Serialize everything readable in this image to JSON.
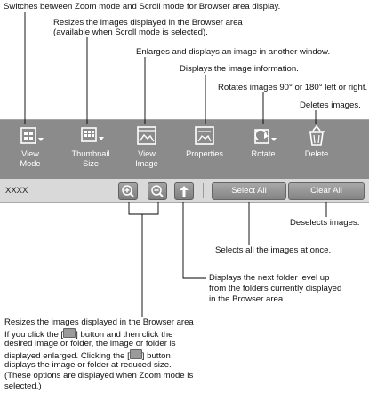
{
  "annotations": {
    "view_mode": "Switches between Zoom mode and Scroll mode for Browser area display.",
    "thumbnail_size_1": "Resizes the images displayed in the Browser area",
    "thumbnail_size_2": "(available when Scroll mode is selected).",
    "view_image": "Enlarges and displays an image in another window.",
    "properties": "Displays the image information.",
    "rotate": "Rotates images 90° or 180° left or right.",
    "delete": "Deletes images.",
    "clear_all": "Deselects images.",
    "select_all": "Selects all the images at once.",
    "up_1": "Displays the next folder level up",
    "up_2": "from the folders currently displayed",
    "up_3": "in the Browser area.",
    "zoom_1": "Resizes the images displayed in the Browser area",
    "zoom_2a": "If you click the [",
    "zoom_2b": "] button and then click the",
    "zoom_3": "desired image or folder, the image or folder is",
    "zoom_4a": "displayed enlarged. Clicking the [",
    "zoom_4b": "] button",
    "zoom_5": "displays the image or folder at reduced size.",
    "zoom_6": "(These options are displayed when Zoom mode is",
    "zoom_7": "selected.)"
  },
  "toolbar": {
    "view_mode": {
      "line1": "View",
      "line2": "Mode",
      "icon": "view-mode-icon"
    },
    "thumbnail_size": {
      "line1": "Thumbnail",
      "line2": "Size",
      "icon": "thumbnail-size-icon"
    },
    "view_image": {
      "line1": "View",
      "line2": "Image",
      "icon": "view-image-icon"
    },
    "properties": {
      "line1": "Properties",
      "icon": "properties-icon"
    },
    "rotate": {
      "line1": "Rotate",
      "icon": "rotate-icon"
    },
    "delete": {
      "line1": "Delete",
      "icon": "trash-icon"
    }
  },
  "selection_bar": {
    "count": "XXXX",
    "select_all": "Select All",
    "clear_all": "Clear All"
  },
  "colors": {
    "toolbar": "#8b8b8b",
    "selection_bar": "#d9d9d9",
    "button": "#909090"
  }
}
